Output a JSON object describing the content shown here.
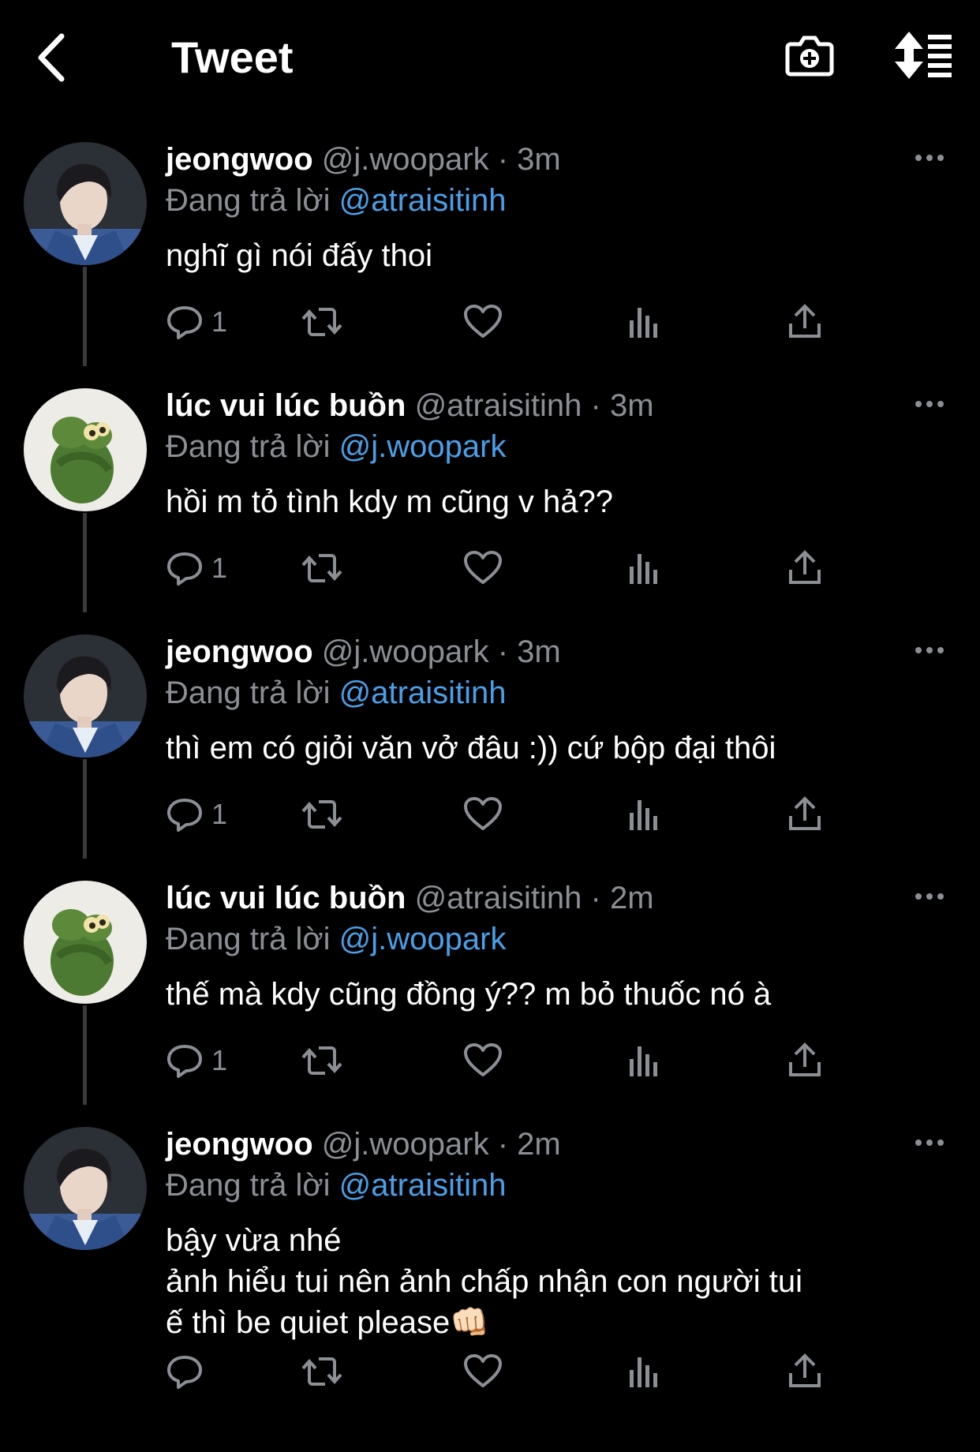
{
  "header": {
    "title": "Tweet",
    "back_icon": "chevron-left-icon",
    "camera_icon": "camera-add-icon",
    "sort_icon": "sort-list-icon"
  },
  "tweets": [
    {
      "name": "jeongwoo",
      "handle": "@j.woopark",
      "dot": "·",
      "time": "3m",
      "reply_prefix": "Đang trả lời",
      "reply_to": "@atraisitinh",
      "text": "nghĩ gì nói đấy thoi",
      "reply_count": "1",
      "avatar": "boy"
    },
    {
      "name": "lúc vui lúc buồn",
      "handle": "@atraisitinh",
      "dot": "·",
      "time": "3m",
      "reply_prefix": "Đang trả lời",
      "reply_to": "@j.woopark",
      "text": "hồi m tỏ tình kdy m cũng v hả??",
      "reply_count": "1",
      "avatar": "frog"
    },
    {
      "name": "jeongwoo",
      "handle": "@j.woopark",
      "dot": "·",
      "time": "3m",
      "reply_prefix": "Đang trả lời",
      "reply_to": "@atraisitinh",
      "text": "thì em có giỏi văn vở đâu :)) cứ bộp đại thôi",
      "reply_count": "1",
      "avatar": "boy"
    },
    {
      "name": "lúc vui lúc buồn",
      "handle": "@atraisitinh",
      "dot": "·",
      "time": "2m",
      "reply_prefix": "Đang trả lời",
      "reply_to": "@j.woopark",
      "text": "thế mà kdy cũng đồng ý?? m bỏ thuốc nó à",
      "reply_count": "1",
      "avatar": "frog"
    },
    {
      "name": "jeongwoo",
      "handle": "@j.woopark",
      "dot": "·",
      "time": "2m",
      "reply_prefix": "Đang trả lời",
      "reply_to": "@atraisitinh",
      "text": "bậy vừa nhé\nảnh hiểu tui nên ảnh chấp nhận con người tui\nế thì be quiet please👊🏻",
      "reply_count": "",
      "avatar": "boy"
    }
  ],
  "colors": {
    "background": "#000000",
    "muted": "#8b8f94",
    "mention": "#4a9fe8",
    "text": "#ffffff"
  }
}
